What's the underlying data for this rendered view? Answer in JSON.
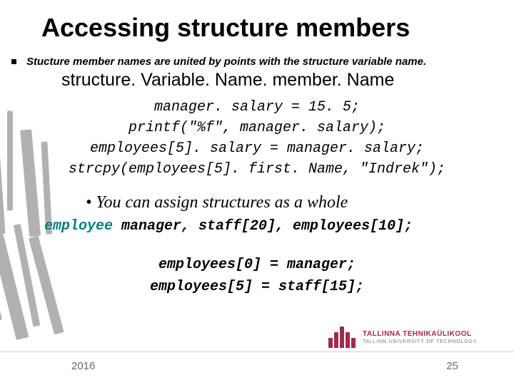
{
  "title": "Accessing structure members",
  "bullet1": "Stucture member names are united by points with the structure variable name.",
  "member_access": "structure. Variable. Name. member. Name",
  "code1": {
    "l1": "manager. salary = 15. 5;",
    "l2": "printf(\"%f\", manager. salary);",
    "l3": "employees[5]. salary = manager. salary;",
    "l4": "strcpy(employees[5]. first. Name, \"Indrek\");"
  },
  "sub_bullet": "• You can assign structures as a whole",
  "decl": {
    "type": "employee",
    "rest": "  manager, staff[20], employees[10];"
  },
  "code2": {
    "l1": "employees[0] = manager;",
    "l2": "employees[5] = staff[15];"
  },
  "footer": {
    "year": "2016",
    "page": "25"
  },
  "logo": {
    "top": "TALLINNA TEHNIKAÜLIKOOL",
    "bottom": "TALLINN UNIVERSITY OF TECHNOLOGY"
  }
}
